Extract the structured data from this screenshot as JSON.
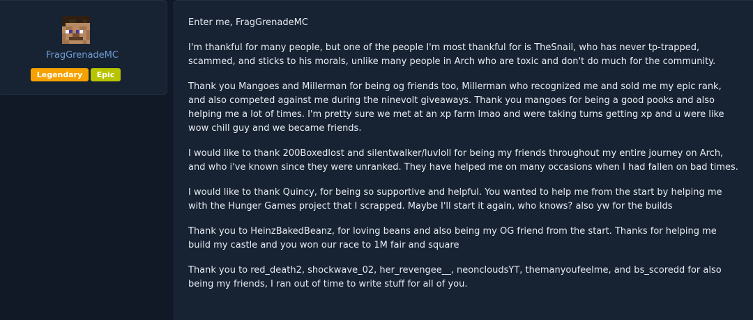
{
  "user": {
    "name": "FragGrenadeMC",
    "badges": [
      {
        "label": "Legendary",
        "color": "#f5a200"
      },
      {
        "label": "Epic",
        "color": "#b8c400"
      }
    ]
  },
  "post": {
    "paragraphs": [
      "Enter me, FragGrenadeMC",
      "I'm thankful for many people, but one of the people I'm most thankful for is TheSnail, who has never tp-trapped, scammed, and sticks to his morals, unlike many people in Arch who are toxic and don't do much for the community.",
      "Thank you Mangoes and Millerman for being og friends too, Millerman who recognized me and sold me my epic rank, and also competed against me during the ninevolt giveaways. Thank you mangoes for being a good pooks and also helping me a lot of times. I'm pretty sure we met at an xp farm lmao and were taking turns getting xp and u were like wow chill guy and we became friends.",
      "I would like to thank 200Boxedlost and silentwalker/luvloll for being my friends throughout my entire journey on Arch, and who i've known since they were unranked. They have helped me on many occasions when I had fallen on bad times.",
      "I would like to thank Quincy, for being so supportive and helpful. You wanted to help me from the start by helping me with the Hunger Games project that I scrapped. Maybe I'll start it again, who knows? also yw for the builds",
      "Thank you to HeinzBakedBeanz, for loving beans and also being my OG friend from the start. Thanks for helping me build my castle and you won our race to 1M fair and square",
      "Thank you to red_death2, shockwave_02, her_revengee__, neoncloudsYT, themanyoufeelme, and bs_scoredd for also being my friends, I ran out of time to write stuff for all of you."
    ]
  },
  "colors": {
    "background": "#111927",
    "card": "#172232",
    "username": "#6e9ed6",
    "text": "#e6ebf2"
  }
}
